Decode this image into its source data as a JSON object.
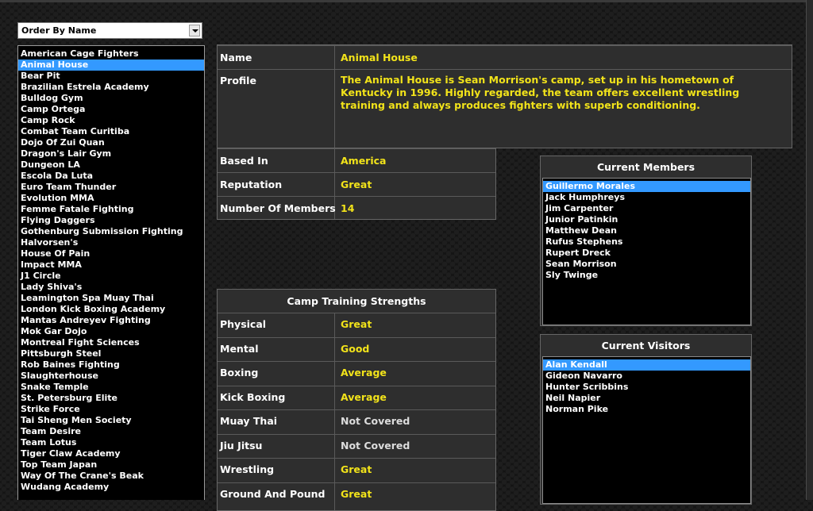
{
  "order_dropdown": {
    "value": "Order By Name"
  },
  "camps": [
    "American Cage Fighters",
    "Animal House",
    "Bear Pit",
    "Brazilian Estrela Academy",
    "Bulldog Gym",
    "Camp Ortega",
    "Camp Rock",
    "Combat Team Curitiba",
    "Dojo Of Zui Quan",
    "Dragon's Lair Gym",
    "Dungeon LA",
    "Escola Da Luta",
    "Euro Team Thunder",
    "Evolution MMA",
    "Femme Fatale Fighting",
    "Flying Daggers",
    "Gothenburg Submission Fighting",
    "Halvorsen's",
    "House Of Pain",
    "Impact MMA",
    "J1 Circle",
    "Lady Shiva's",
    "Leamington Spa Muay Thai",
    "London Kick Boxing Academy",
    "Mantas Andreyev Fighting",
    "Mok Gar Dojo",
    "Montreal Fight Sciences",
    "Pittsburgh Steel",
    "Rob Baines Fighting",
    "Slaughterhouse",
    "Snake Temple",
    "St. Petersburg Elite",
    "Strike Force",
    "Tai Sheng Men Society",
    "Team Desire",
    "Team Lotus",
    "Tiger Claw Academy",
    "Top Team Japan",
    "Way Of The Crane's Beak",
    "Wudang Academy"
  ],
  "selected_camp_index": 1,
  "details": {
    "name_label": "Name",
    "name_value": "Animal House",
    "profile_label": "Profile",
    "profile_value": "The Animal House is Sean Morrison's camp, set up in his hometown of Kentucky in 1996. Highly regarded, the team offers excellent wrestling training and always produces fighters with superb conditioning."
  },
  "info": [
    {
      "label": "Based In",
      "value": "America"
    },
    {
      "label": "Reputation",
      "value": "Great"
    },
    {
      "label": "Number Of Members",
      "value": "14"
    }
  ],
  "strengths": {
    "title": "Camp Training Strengths",
    "rows": [
      {
        "label": "Physical",
        "value": "Great",
        "covered": true
      },
      {
        "label": "Mental",
        "value": "Good",
        "covered": true
      },
      {
        "label": "Boxing",
        "value": "Average",
        "covered": true
      },
      {
        "label": "Kick Boxing",
        "value": "Average",
        "covered": true
      },
      {
        "label": "Muay Thai",
        "value": "Not Covered",
        "covered": false
      },
      {
        "label": "Jiu Jitsu",
        "value": "Not Covered",
        "covered": false
      },
      {
        "label": "Wrestling",
        "value": "Great",
        "covered": true
      },
      {
        "label": "Ground And Pound",
        "value": "Great",
        "covered": true
      }
    ]
  },
  "members": {
    "title": "Current Members",
    "names": [
      "Guillermo Morales",
      "Jack Humphreys",
      "Jim Carpenter",
      "Junior Patinkin",
      "Matthew Dean",
      "Rufus Stephens",
      "Rupert Dreck",
      "Sean Morrison",
      "Sly Twinge"
    ],
    "selected_index": 0
  },
  "visitors": {
    "title": "Current Visitors",
    "names": [
      "Alan Kendall",
      "Gideon Navarro",
      "Hunter Scribbins",
      "Neil Napier",
      "Norman Pike"
    ],
    "selected_index": 0
  },
  "colors": {
    "value_yellow": "#f2e31a",
    "selection_blue": "#3399ff"
  }
}
